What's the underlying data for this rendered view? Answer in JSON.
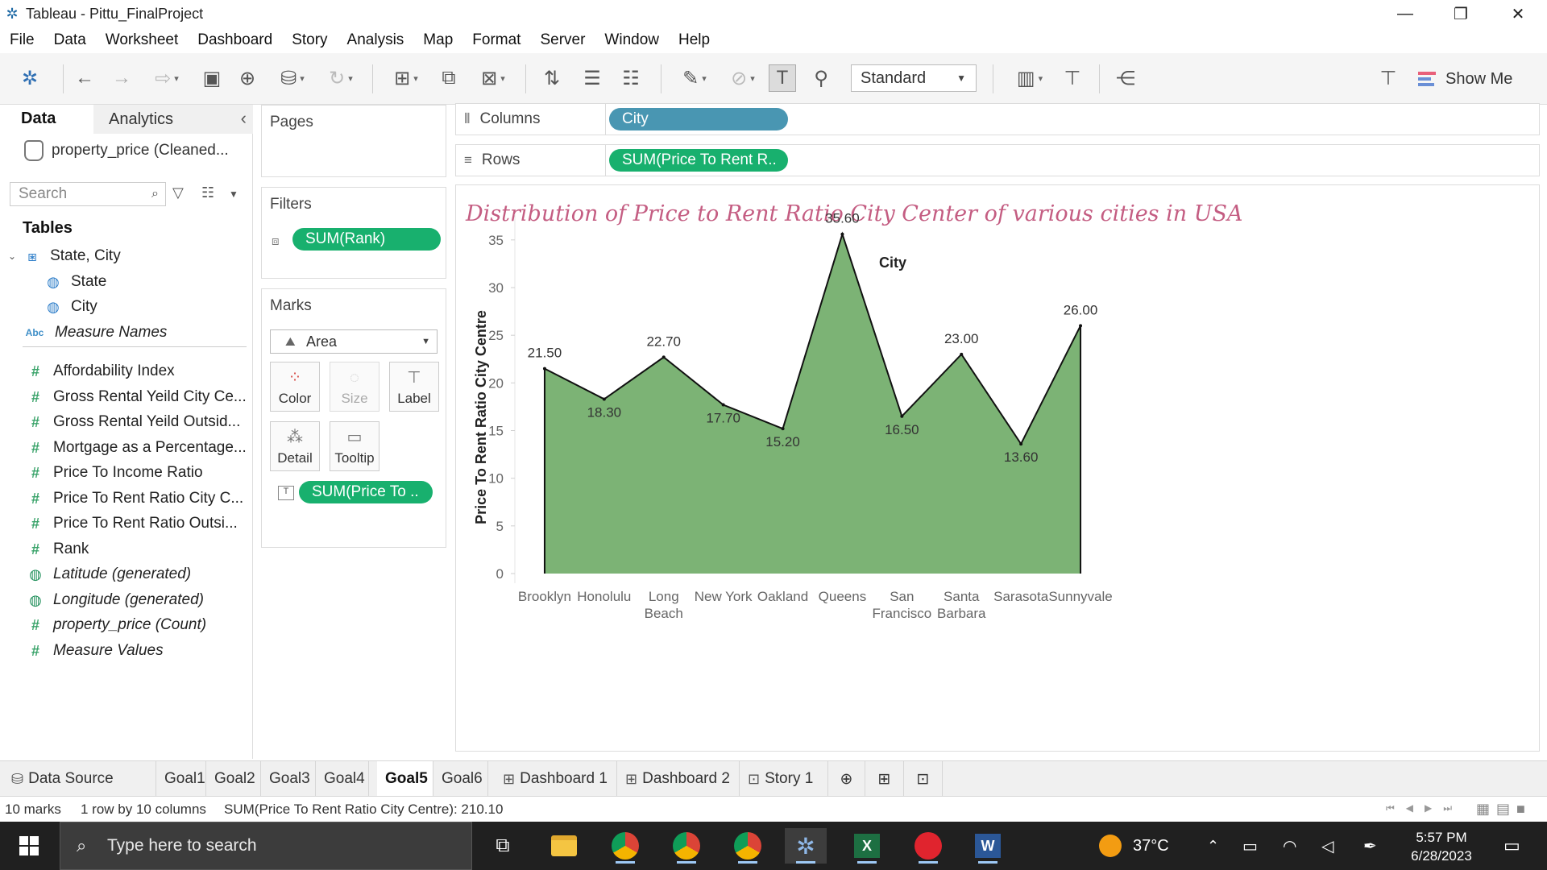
{
  "window": {
    "title": "Tableau - Pittu_FinalProject",
    "controls": {
      "minimize": "—",
      "restore": "❐",
      "close": "✕"
    }
  },
  "menu": [
    "File",
    "Data",
    "Worksheet",
    "Dashboard",
    "Story",
    "Analysis",
    "Map",
    "Format",
    "Server",
    "Window",
    "Help"
  ],
  "toolbar": {
    "fit_select": "Standard",
    "show_me_label": "Show Me"
  },
  "data_pane": {
    "tab_data": "Data",
    "tab_analytics": "Analytics",
    "data_source": "property_price (Cleaned...",
    "search_placeholder": "Search",
    "tables_heading": "Tables",
    "hierarchy": {
      "name": "State, City",
      "children": [
        "State",
        "City"
      ]
    },
    "measure_names": "Measure Names",
    "measures": [
      "Affordability Index",
      "Gross Rental Yeild City Ce...",
      "Gross Rental Yeild Outsid...",
      "Mortgage as a Percentage...",
      "Price To Income Ratio",
      "Price To Rent Ratio City C...",
      "Price To Rent Ratio Outsi...",
      "Rank"
    ],
    "generated": [
      "Latitude (generated)",
      "Longitude (generated)",
      "property_price (Count)",
      "Measure Values"
    ]
  },
  "cards": {
    "pages": "Pages",
    "filters": "Filters",
    "filter_pill": "SUM(Rank)",
    "marks": "Marks",
    "mark_type": "Area",
    "mark_buttons": [
      "Color",
      "Size",
      "Label",
      "Detail",
      "Tooltip"
    ],
    "marks_pill": "SUM(Price To .."
  },
  "shelves": {
    "columns_label": "Columns",
    "columns_pill": "City",
    "rows_label": "Rows",
    "rows_pill": "SUM(Price To Rent R.."
  },
  "chart_data": {
    "type": "area",
    "title": "Distribution of Price to Rent Ratio City Center of various cities in USA",
    "xlabel": "City",
    "ylabel": "Price To Rent Ratio City Centre",
    "categories": [
      "Brooklyn",
      "Honolulu",
      "Long Beach",
      "New York",
      "Oakland",
      "Queens",
      "San Francisco",
      "Santa Barbara",
      "Sarasota",
      "Sunnyvale"
    ],
    "category_lines": [
      [
        "Brooklyn"
      ],
      [
        "Honolulu"
      ],
      [
        "Long",
        "Beach"
      ],
      [
        "New York"
      ],
      [
        "Oakland"
      ],
      [
        "Queens"
      ],
      [
        "San",
        "Francisco"
      ],
      [
        "Santa",
        "Barbara"
      ],
      [
        "Sarasota"
      ],
      [
        "Sunnyvale"
      ]
    ],
    "values": [
      21.5,
      18.3,
      22.7,
      17.7,
      15.2,
      35.6,
      16.5,
      23.0,
      13.6,
      26.0
    ],
    "data_labels": [
      "21.50",
      "18.30",
      "22.70",
      "17.70",
      "15.20",
      "35.60",
      "16.50",
      "23.00",
      "13.60",
      "26.00"
    ],
    "yticks": [
      0,
      5,
      10,
      15,
      20,
      25,
      30,
      35
    ],
    "ylim": [
      0,
      36
    ],
    "fill_color": "#7cb375",
    "line_color": "#111111",
    "title_color": "#c45d82",
    "grid": false
  },
  "sheet_tabs": {
    "data_source": "Data Source",
    "sheets": [
      "Goal1",
      "Goal2",
      "Goal3",
      "Goal4",
      "Goal5",
      "Goal6"
    ],
    "active_sheet": "Goal5",
    "dashboards": [
      "Dashboard 1",
      "Dashboard 2"
    ],
    "story": "Story 1"
  },
  "status": {
    "marks": "10 marks",
    "dims": "1 row by 10 columns",
    "sum": "SUM(Price To Rent Ratio City Centre): 210.10"
  },
  "taskbar": {
    "search_placeholder": "Type here to search",
    "temperature": "37°C",
    "time": "5:57 PM",
    "date": "6/28/2023"
  }
}
